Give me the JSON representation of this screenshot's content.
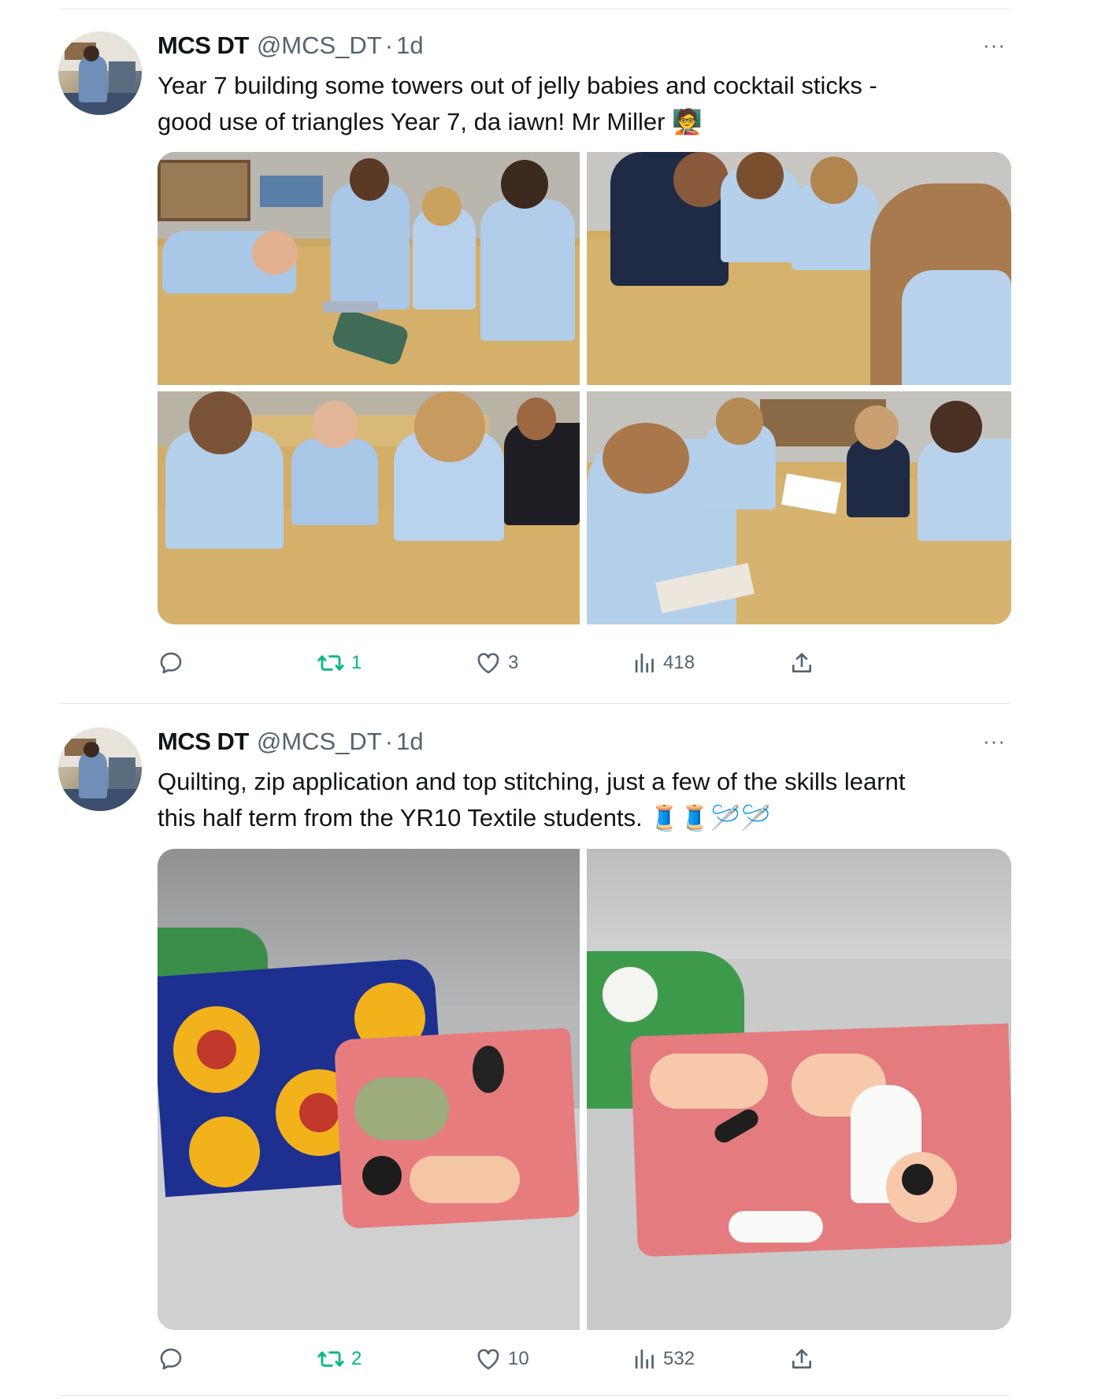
{
  "tweets": [
    {
      "author_name": "MCS DT",
      "handle": "@MCS_DT",
      "separator": "·",
      "time": "1d",
      "more": "···",
      "text": "Year 7 building some towers out of jelly babies and cocktail sticks -\ngood use of triangles Year 7, da iawn! Mr Miller 🧑‍🏫",
      "stats": {
        "replies": "",
        "retweets": "1",
        "likes": "3",
        "views": "418"
      }
    },
    {
      "author_name": "MCS DT",
      "handle": "@MCS_DT",
      "separator": "·",
      "time": "1d",
      "more": "···",
      "text": "Quilting, zip application and top stitching, just a few of the skills learnt\nthis half term from the YR10 Textile students. 🧵🧵🪡🪡",
      "stats": {
        "replies": "",
        "retweets": "2",
        "likes": "10",
        "views": "532"
      }
    }
  ],
  "icons": {
    "reply": "reply-icon",
    "retweet": "retweet-icon",
    "like": "heart-icon",
    "views": "views-icon",
    "share": "share-icon"
  },
  "colors": {
    "text": "#0f1419",
    "secondary": "#536471",
    "retweet_green": "#00ba7c",
    "divider": "#e1e6ea"
  }
}
